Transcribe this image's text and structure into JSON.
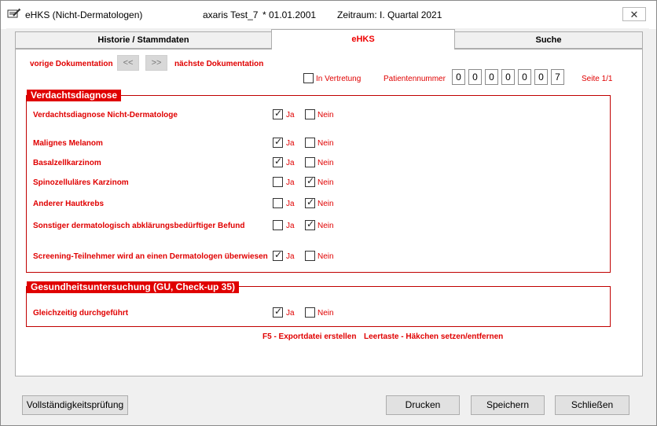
{
  "window": {
    "title": "eHKS (Nicht-Dermatologen)",
    "patient": "axaris Test_7",
    "birthdate": "* 01.01.2001",
    "period": "Zeitraum: I. Quartal 2021",
    "close_label": "✕"
  },
  "tabs": [
    {
      "label": "Historie / Stammdaten",
      "active": false
    },
    {
      "label": "eHKS",
      "active": true
    },
    {
      "label": "Suche",
      "active": false
    }
  ],
  "nav": {
    "prev_label": "vorige Dokumentation",
    "next_label": "nächste Dokumentation",
    "prev_btn": "<<",
    "next_btn": ">>"
  },
  "header": {
    "vertretung_label": "In Vertretung",
    "vertretung_checked": false,
    "patientnr_label": "Patientennummer",
    "patientnr_digits": [
      "0",
      "0",
      "0",
      "0",
      "0",
      "0",
      "7"
    ],
    "page_label": "Seite 1/1"
  },
  "verdacht": {
    "title": "Verdachtsdiagnose",
    "rows": [
      {
        "label": "Verdachtsdiagnose Nicht-Dermatologe",
        "ja": true,
        "nein": false
      },
      {
        "label": "Malignes Melanom",
        "ja": true,
        "nein": false
      },
      {
        "label": "Basalzellkarzinom",
        "ja": true,
        "nein": false
      },
      {
        "label": "Spinozelluläres Karzinom",
        "ja": false,
        "nein": true
      },
      {
        "label": "Anderer Hautkrebs",
        "ja": false,
        "nein": true
      },
      {
        "label": "Sonstiger dermatologisch abklärungsbedürftiger Befund",
        "ja": false,
        "nein": true
      },
      {
        "label": "Screening-Teilnehmer wird an einen Dermatologen überwiesen",
        "ja": true,
        "nein": false
      }
    ]
  },
  "gu": {
    "title": "Gesundheitsuntersuchung (GU, Check-up 35)",
    "rows": [
      {
        "label": "Gleichzeitig durchgeführt",
        "ja": true,
        "nein": false
      }
    ]
  },
  "options": {
    "ja": "Ja",
    "nein": "Nein"
  },
  "hints": {
    "f5": "F5 - Exportdatei erstellen",
    "space": "Leertaste - Häkchen setzen/entfernen"
  },
  "buttons": {
    "check": "Vollständigkeitsprüfung",
    "print": "Drucken",
    "save": "Speichern",
    "close": "Schließen"
  }
}
